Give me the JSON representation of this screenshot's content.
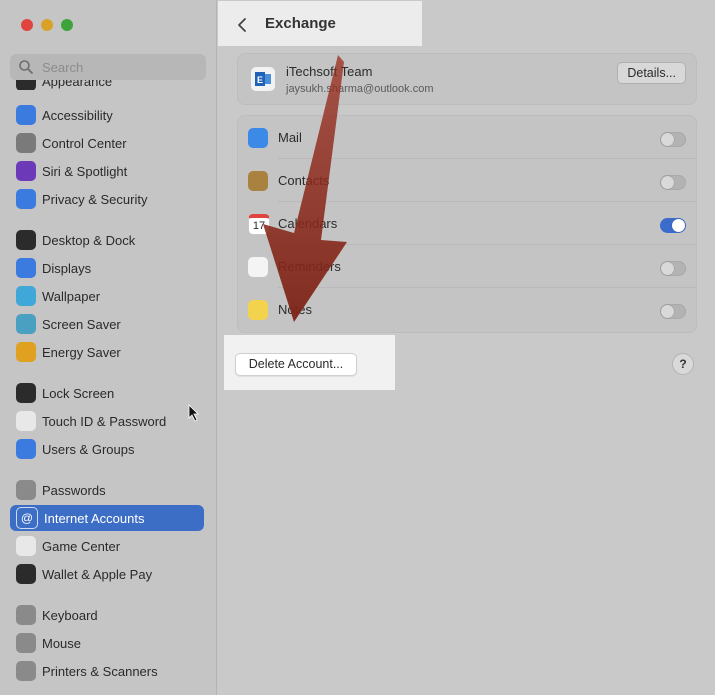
{
  "sidebar": {
    "search_placeholder": "Search",
    "partial_top_label": "Appearance",
    "items": [
      {
        "label": "Accessibility",
        "icon": "accessibility-icon",
        "color": "#3b7be0"
      },
      {
        "label": "Control Center",
        "icon": "control-center-icon",
        "color": "#7a7a7a"
      },
      {
        "label": "Siri & Spotlight",
        "icon": "siri-icon",
        "color": "#6c3ab8"
      },
      {
        "label": "Privacy & Security",
        "icon": "hand-icon",
        "color": "#3b7be0"
      },
      {
        "label": "Desktop & Dock",
        "icon": "dock-icon",
        "color": "#2b2b2b"
      },
      {
        "label": "Displays",
        "icon": "displays-icon",
        "color": "#3b7be0"
      },
      {
        "label": "Wallpaper",
        "icon": "wallpaper-icon",
        "color": "#40a8d8"
      },
      {
        "label": "Screen Saver",
        "icon": "screen-saver-icon",
        "color": "#4aa0c0"
      },
      {
        "label": "Energy Saver",
        "icon": "energy-icon",
        "color": "#e0a020"
      },
      {
        "label": "Lock Screen",
        "icon": "lock-icon",
        "color": "#2b2b2b"
      },
      {
        "label": "Touch ID & Password",
        "icon": "fingerprint-icon",
        "color": "#e8e8e8"
      },
      {
        "label": "Users & Groups",
        "icon": "users-icon",
        "color": "#3b7be0"
      },
      {
        "label": "Passwords",
        "icon": "key-icon",
        "color": "#8a8a8a"
      },
      {
        "label": "Internet Accounts",
        "icon": "at-icon",
        "color": "#3b7be0",
        "selected": true
      },
      {
        "label": "Game Center",
        "icon": "game-center-icon",
        "color": "#e8e8e8"
      },
      {
        "label": "Wallet & Apple Pay",
        "icon": "wallet-icon",
        "color": "#2b2b2b"
      },
      {
        "label": "Keyboard",
        "icon": "keyboard-icon",
        "color": "#8a8a8a"
      },
      {
        "label": "Mouse",
        "icon": "mouse-icon",
        "color": "#8a8a8a"
      },
      {
        "label": "Printers & Scanners",
        "icon": "printer-icon",
        "color": "#8a8a8a"
      }
    ]
  },
  "header": {
    "title": "Exchange"
  },
  "account": {
    "name": "iTechsoft Team",
    "email": "jaysukh.sharma@outlook.com",
    "details_label": "Details..."
  },
  "services": [
    {
      "label": "Mail",
      "icon": "mail-icon",
      "color": "#3b8ae8",
      "enabled": false
    },
    {
      "label": "Contacts",
      "icon": "contacts-icon",
      "color": "#a8823e",
      "enabled": false
    },
    {
      "label": "Calendars",
      "icon": "calendar-icon",
      "color": "#ffffff",
      "enabled": true
    },
    {
      "label": "Reminders",
      "icon": "reminders-icon",
      "color": "#f4f4f4",
      "enabled": false
    },
    {
      "label": "Notes",
      "icon": "notes-icon",
      "color": "#f3d24e",
      "enabled": false
    }
  ],
  "calendar_day": "17",
  "footer": {
    "delete_label": "Delete Account...",
    "help_label": "?"
  },
  "colors": {
    "accent": "#3d6ec6",
    "arrow": "#8e2a1c"
  }
}
